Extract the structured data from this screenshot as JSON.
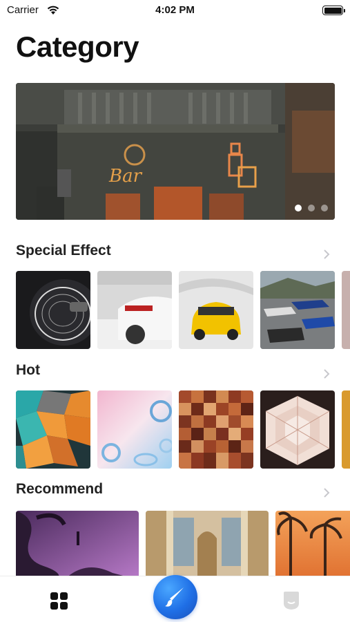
{
  "status_bar": {
    "carrier": "Carrier",
    "time": "4:02 PM"
  },
  "page": {
    "title": "Category"
  },
  "banner": {
    "dot_count": 3,
    "active_dot": 0
  },
  "sections": {
    "special_effect": {
      "title": "Special Effect"
    },
    "hot": {
      "title": "Hot"
    },
    "recommend": {
      "title": "Recommend"
    }
  },
  "icons": {
    "wifi": "wifi-icon",
    "battery": "battery-icon",
    "chevron": "chevron-right-icon",
    "tab_left": "grid-icon",
    "tab_center": "brush-icon",
    "tab_right": "profile-icon"
  },
  "colors": {
    "accent": "#1f6fe6",
    "text": "#111111",
    "chevron": "#c7c7cc"
  }
}
